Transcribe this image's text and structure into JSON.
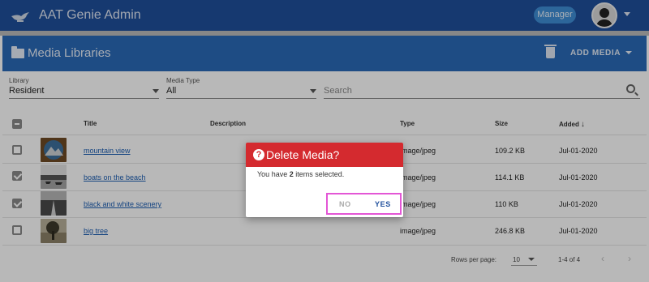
{
  "app": {
    "title": "AAT Genie Admin",
    "role_label": "Manager"
  },
  "card": {
    "title": "Media Libraries",
    "add_media_label": "ADD MEDIA"
  },
  "filters": {
    "library_label": "Library",
    "library_value": "Resident",
    "media_type_label": "Media Type",
    "media_type_value": "All",
    "search_placeholder": "Search"
  },
  "table": {
    "headers": {
      "title": "Title",
      "description": "Description",
      "type": "Type",
      "size": "Size",
      "added": "Added"
    },
    "rows": [
      {
        "title": "mountain view",
        "description": "",
        "type": "image/jpeg",
        "size": "109.2 KB",
        "added": "Jul-01-2020",
        "checked": false,
        "thumb": "mountain-thumbnail"
      },
      {
        "title": "boats on the beach",
        "description": "",
        "type": "image/jpeg",
        "size": "114.1 KB",
        "added": "Jul-01-2020",
        "checked": true,
        "thumb": "boats-thumbnail"
      },
      {
        "title": "black and white scenery",
        "description": "",
        "type": "image/jpeg",
        "size": "110 KB",
        "added": "Jul-01-2020",
        "checked": true,
        "thumb": "scenery-thumbnail"
      },
      {
        "title": "big tree",
        "description": "",
        "type": "image/jpeg",
        "size": "246.8 KB",
        "added": "Jul-01-2020",
        "checked": false,
        "thumb": "tree-thumbnail"
      }
    ]
  },
  "pagination": {
    "rows_per_page_label": "Rows per page:",
    "rows_per_page_value": "10",
    "range": "1-4 of 4"
  },
  "dialog": {
    "title": "Delete Media?",
    "message_prefix": "You have ",
    "count": "2",
    "message_suffix": " items selected.",
    "no_label": "NO",
    "yes_label": "YES"
  },
  "colors": {
    "topbar": "#1f4f9c",
    "header": "#2a6ab8",
    "danger": "#d42a2f",
    "link": "#1e5fb3",
    "highlight": "#e356d6"
  },
  "icons": [
    "genie-lamp-logo",
    "avatar",
    "folder-icon",
    "trash-icon",
    "search-icon",
    "help-icon",
    "sort-down-icon"
  ]
}
